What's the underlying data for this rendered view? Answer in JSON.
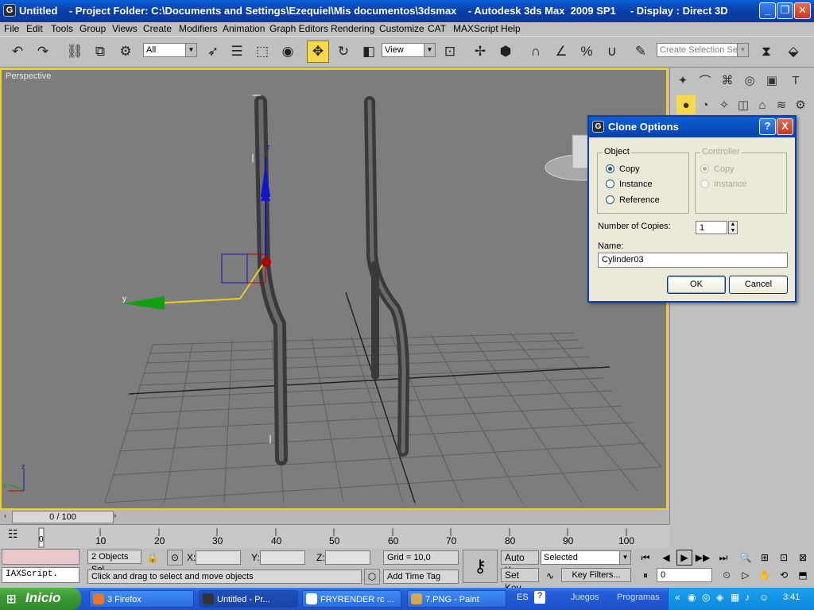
{
  "window": {
    "title": "Untitled    - Project Folder: C:\\Documents and Settings\\Ezequiel\\Mis documentos\\3dsmax    - Autodesk 3ds Max  2009 SP1     - Display : Direct 3D",
    "app_icon": "G"
  },
  "menu": [
    "File",
    "Edit",
    "Tools",
    "Group",
    "Views",
    "Create",
    "Modifiers",
    "Animation",
    "Graph Editors",
    "Rendering",
    "Customize",
    "CAT",
    "MAXScript",
    "Help"
  ],
  "toolbar": {
    "selection_filter": "All",
    "reference_coord": "View",
    "selection_set_placeholder": "Create Selection Set",
    "accent": "#f6d84a"
  },
  "viewport": {
    "label": "Perspective",
    "bg": "#7d7d7d",
    "grid_color": "#5d5d5d",
    "axis_x_label": "x",
    "axis_z_label": "z",
    "axis_y_label": "y",
    "gizmo_z_label": "z"
  },
  "dialog": {
    "title": "Clone Options",
    "help_label": "?",
    "close_label": "X",
    "object_group": "Object",
    "object_options": [
      "Copy",
      "Instance",
      "Reference"
    ],
    "object_selected": "Copy",
    "controller_group": "Controller",
    "controller_options": [
      "Copy",
      "Instance"
    ],
    "copies_label": "Number of Copies:",
    "copies_value": "1",
    "name_label": "Name:",
    "name_value": "Cylinder03",
    "ok": "OK",
    "cancel": "Cancel"
  },
  "timeline": {
    "slider_text": "0 / 100",
    "ticks": [
      "0",
      "10",
      "20",
      "30",
      "40",
      "50",
      "60",
      "70",
      "80",
      "90",
      "100"
    ]
  },
  "status": {
    "selection": "2 Objects Sel",
    "x_label": "X:",
    "y_label": "Y:",
    "z_label": "Z:",
    "x_value": "",
    "y_value": "",
    "z_value": "",
    "grid": "Grid = 10,0",
    "prompt": "Click and drag to select and move objects",
    "add_time_tag": "Add Time Tag",
    "auto_key": "Auto Key",
    "set_key": "Set Key",
    "key_mode": "Selected",
    "key_filters": "Key Filters...",
    "frame": "0",
    "maxscript": "IAXScript."
  },
  "taskbar": {
    "start": "Inicio",
    "tasks": [
      {
        "label": "3 Firefox",
        "color": "#e8762a"
      },
      {
        "label": "Untitled    - Pr...",
        "color": "#333333"
      },
      {
        "label": "FRYRENDER rc ...",
        "color": "#ffffff"
      },
      {
        "label": "7.PNG - Paint",
        "color": "#d6a84a"
      }
    ],
    "lang": "ES",
    "quick1": "Juegos",
    "quick2": "Programas",
    "clock": "3:41"
  }
}
